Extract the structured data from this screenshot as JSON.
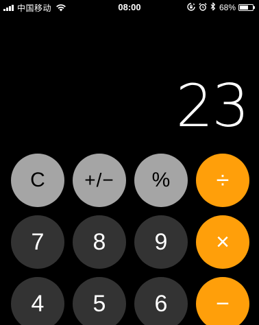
{
  "status_bar": {
    "carrier": "中国移动",
    "time": "08:00",
    "battery_percent": "68%",
    "battery_level": 0.68,
    "icons": [
      "signal-icon",
      "wifi-icon",
      "orientation-lock-icon",
      "alarm-icon",
      "bluetooth-icon",
      "battery-icon"
    ]
  },
  "display": {
    "value": "23"
  },
  "keypad": {
    "row1": {
      "clear": "C",
      "sign": "+/−",
      "percent": "%",
      "divide": "÷"
    },
    "row2": {
      "seven": "7",
      "eight": "8",
      "nine": "9",
      "multiply": "×"
    },
    "row3": {
      "four": "4",
      "five": "5",
      "six": "6",
      "minus": "−"
    }
  },
  "colors": {
    "background": "#000000",
    "function_key": "#a5a5a5",
    "number_key": "#333333",
    "operator_key": "#ff9f0a"
  }
}
